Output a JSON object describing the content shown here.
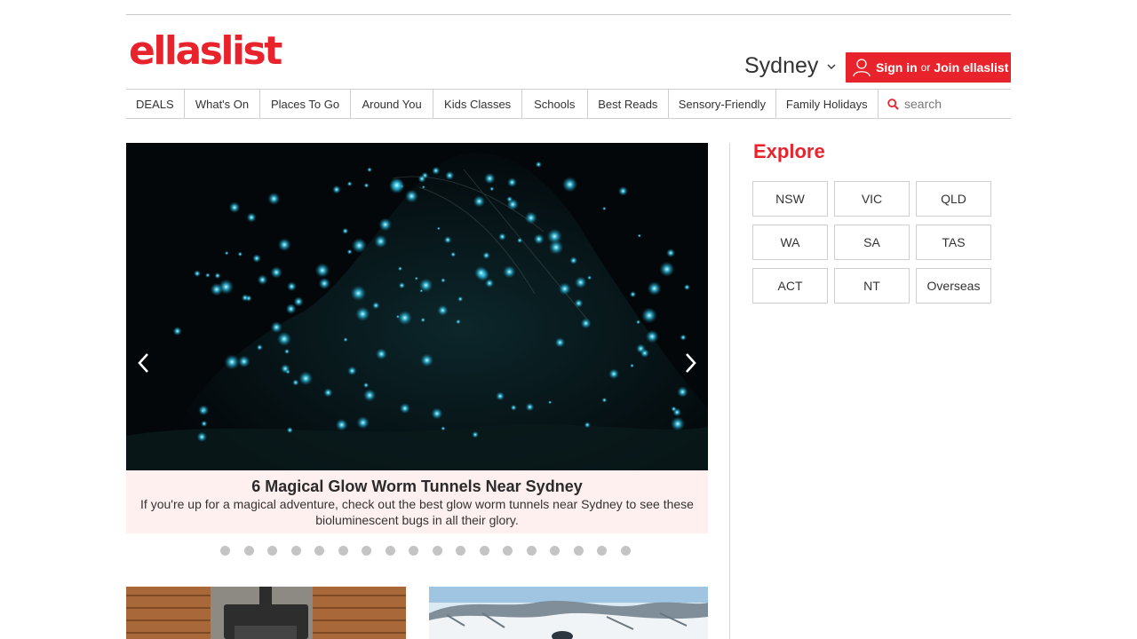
{
  "header": {
    "logo_text": "ellaslist",
    "city": "Sydney",
    "signin": {
      "sign_in": "Sign in",
      "or": "or",
      "join": "Join ellaslist"
    }
  },
  "nav": {
    "items": [
      "DEALS",
      "What's On",
      "Places To Go",
      "Around You",
      "Kids Classes",
      "Schools",
      "Best Reads",
      "Sensory-Friendly",
      "Family Holidays"
    ],
    "search_placeholder": "search"
  },
  "hero": {
    "title": "6 Magical Glow Worm Tunnels Near Sydney",
    "description": "If you're up for a magical adventure, check out the best glow worm tunnels near Sydney to see these bioluminescent bugs in all their glory.",
    "slide_count": 18
  },
  "explore": {
    "title": "Explore",
    "regions": [
      "NSW",
      "VIC",
      "QLD",
      "WA",
      "SA",
      "TAS",
      "ACT",
      "NT",
      "Overseas"
    ]
  },
  "colors": {
    "brand_red": "#e8232b",
    "caption_bg": "#fdf0ef"
  }
}
